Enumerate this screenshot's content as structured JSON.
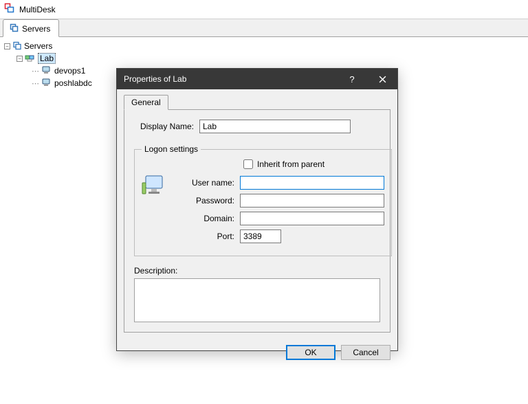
{
  "app": {
    "title": "MultiDesk"
  },
  "main_tab": {
    "label": "Servers"
  },
  "tree": {
    "root": "Servers",
    "group": "Lab",
    "node1": "devops1",
    "node2": "poshlabdc"
  },
  "dialog": {
    "title": "Properties of Lab",
    "tab_general": "General",
    "display_name_label": "Display Name:",
    "display_name_value": "Lab",
    "logon_legend": "Logon settings",
    "inherit_label": "Inherit from parent",
    "inherit_checked": false,
    "user_label": "User name:",
    "user_value": "",
    "password_label": "Password:",
    "password_value": "",
    "domain_label": "Domain:",
    "domain_value": "",
    "port_label": "Port:",
    "port_value": "3389",
    "description_label": "Description:",
    "description_value": "",
    "ok_label": "OK",
    "cancel_label": "Cancel"
  }
}
